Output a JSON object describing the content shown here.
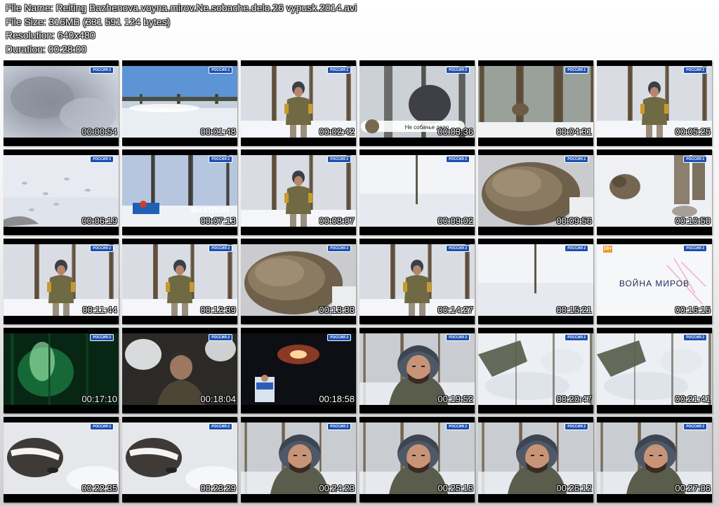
{
  "file_info": {
    "name_label": "File Name: Reiting Bazhenova.voyna.mirov.Ne.sobache.delo.26 vypusk.2014.avi",
    "size_label": "File Size: 316MB (331 591 124 bytes)",
    "resolution_label": "Resolution: 640x480",
    "duration_label": "Duration: 00:28:00"
  },
  "channel_logo_text": "РОССИЯ 2",
  "thumbnails": [
    {
      "timestamp": "00:00:54",
      "scene": "fog"
    },
    {
      "timestamp": "00:01:48",
      "scene": "river"
    },
    {
      "timestamp": "00:02:42",
      "scene": "hunter-forest"
    },
    {
      "timestamp": "00:03:36",
      "scene": "title-card",
      "caption": "Не собачье дело"
    },
    {
      "timestamp": "00:04:31",
      "scene": "forest-dark"
    },
    {
      "timestamp": "00:05:25",
      "scene": "hunter-forest"
    },
    {
      "timestamp": "00:06:19",
      "scene": "snow-tracks"
    },
    {
      "timestamp": "00:07:13",
      "scene": "biathlon",
      "caption": "БИАТЛОН"
    },
    {
      "timestamp": "00:08:07",
      "scene": "hunter-forest"
    },
    {
      "timestamp": "00:09:02",
      "scene": "snow-plain"
    },
    {
      "timestamp": "00:09:56",
      "scene": "fur"
    },
    {
      "timestamp": "00:10:50",
      "scene": "raccoon-dog"
    },
    {
      "timestamp": "00:11:44",
      "scene": "hunter-forest"
    },
    {
      "timestamp": "00:12:39",
      "scene": "hunter-forest"
    },
    {
      "timestamp": "00:13:33",
      "scene": "fur"
    },
    {
      "timestamp": "00:14:27",
      "scene": "hunter-forest"
    },
    {
      "timestamp": "00:15:21",
      "scene": "snow-plain"
    },
    {
      "timestamp": "00:16:15",
      "scene": "logo-card",
      "caption": "ВОЙНА МИРОВ",
      "rating": "16+"
    },
    {
      "timestamp": "00:17:10",
      "scene": "nightvision"
    },
    {
      "timestamp": "00:18:04",
      "scene": "man-dark"
    },
    {
      "timestamp": "00:18:58",
      "scene": "night-fire"
    },
    {
      "timestamp": "00:19:52",
      "scene": "man-closeup"
    },
    {
      "timestamp": "00:20:47",
      "scene": "snow-lair"
    },
    {
      "timestamp": "00:21:41",
      "scene": "snow-lair"
    },
    {
      "timestamp": "00:22:35",
      "scene": "badger"
    },
    {
      "timestamp": "00:23:29",
      "scene": "badger"
    },
    {
      "timestamp": "00:24:23",
      "scene": "man-closeup"
    },
    {
      "timestamp": "00:25:18",
      "scene": "man-closeup"
    },
    {
      "timestamp": "00:26:12",
      "scene": "man-closeup"
    },
    {
      "timestamp": "00:27:06",
      "scene": "man-closeup"
    }
  ],
  "colors": {
    "thumb_border": "#000000",
    "channel_logo_bg": "#1b4fb0",
    "rating_badge": "#e8a030"
  }
}
